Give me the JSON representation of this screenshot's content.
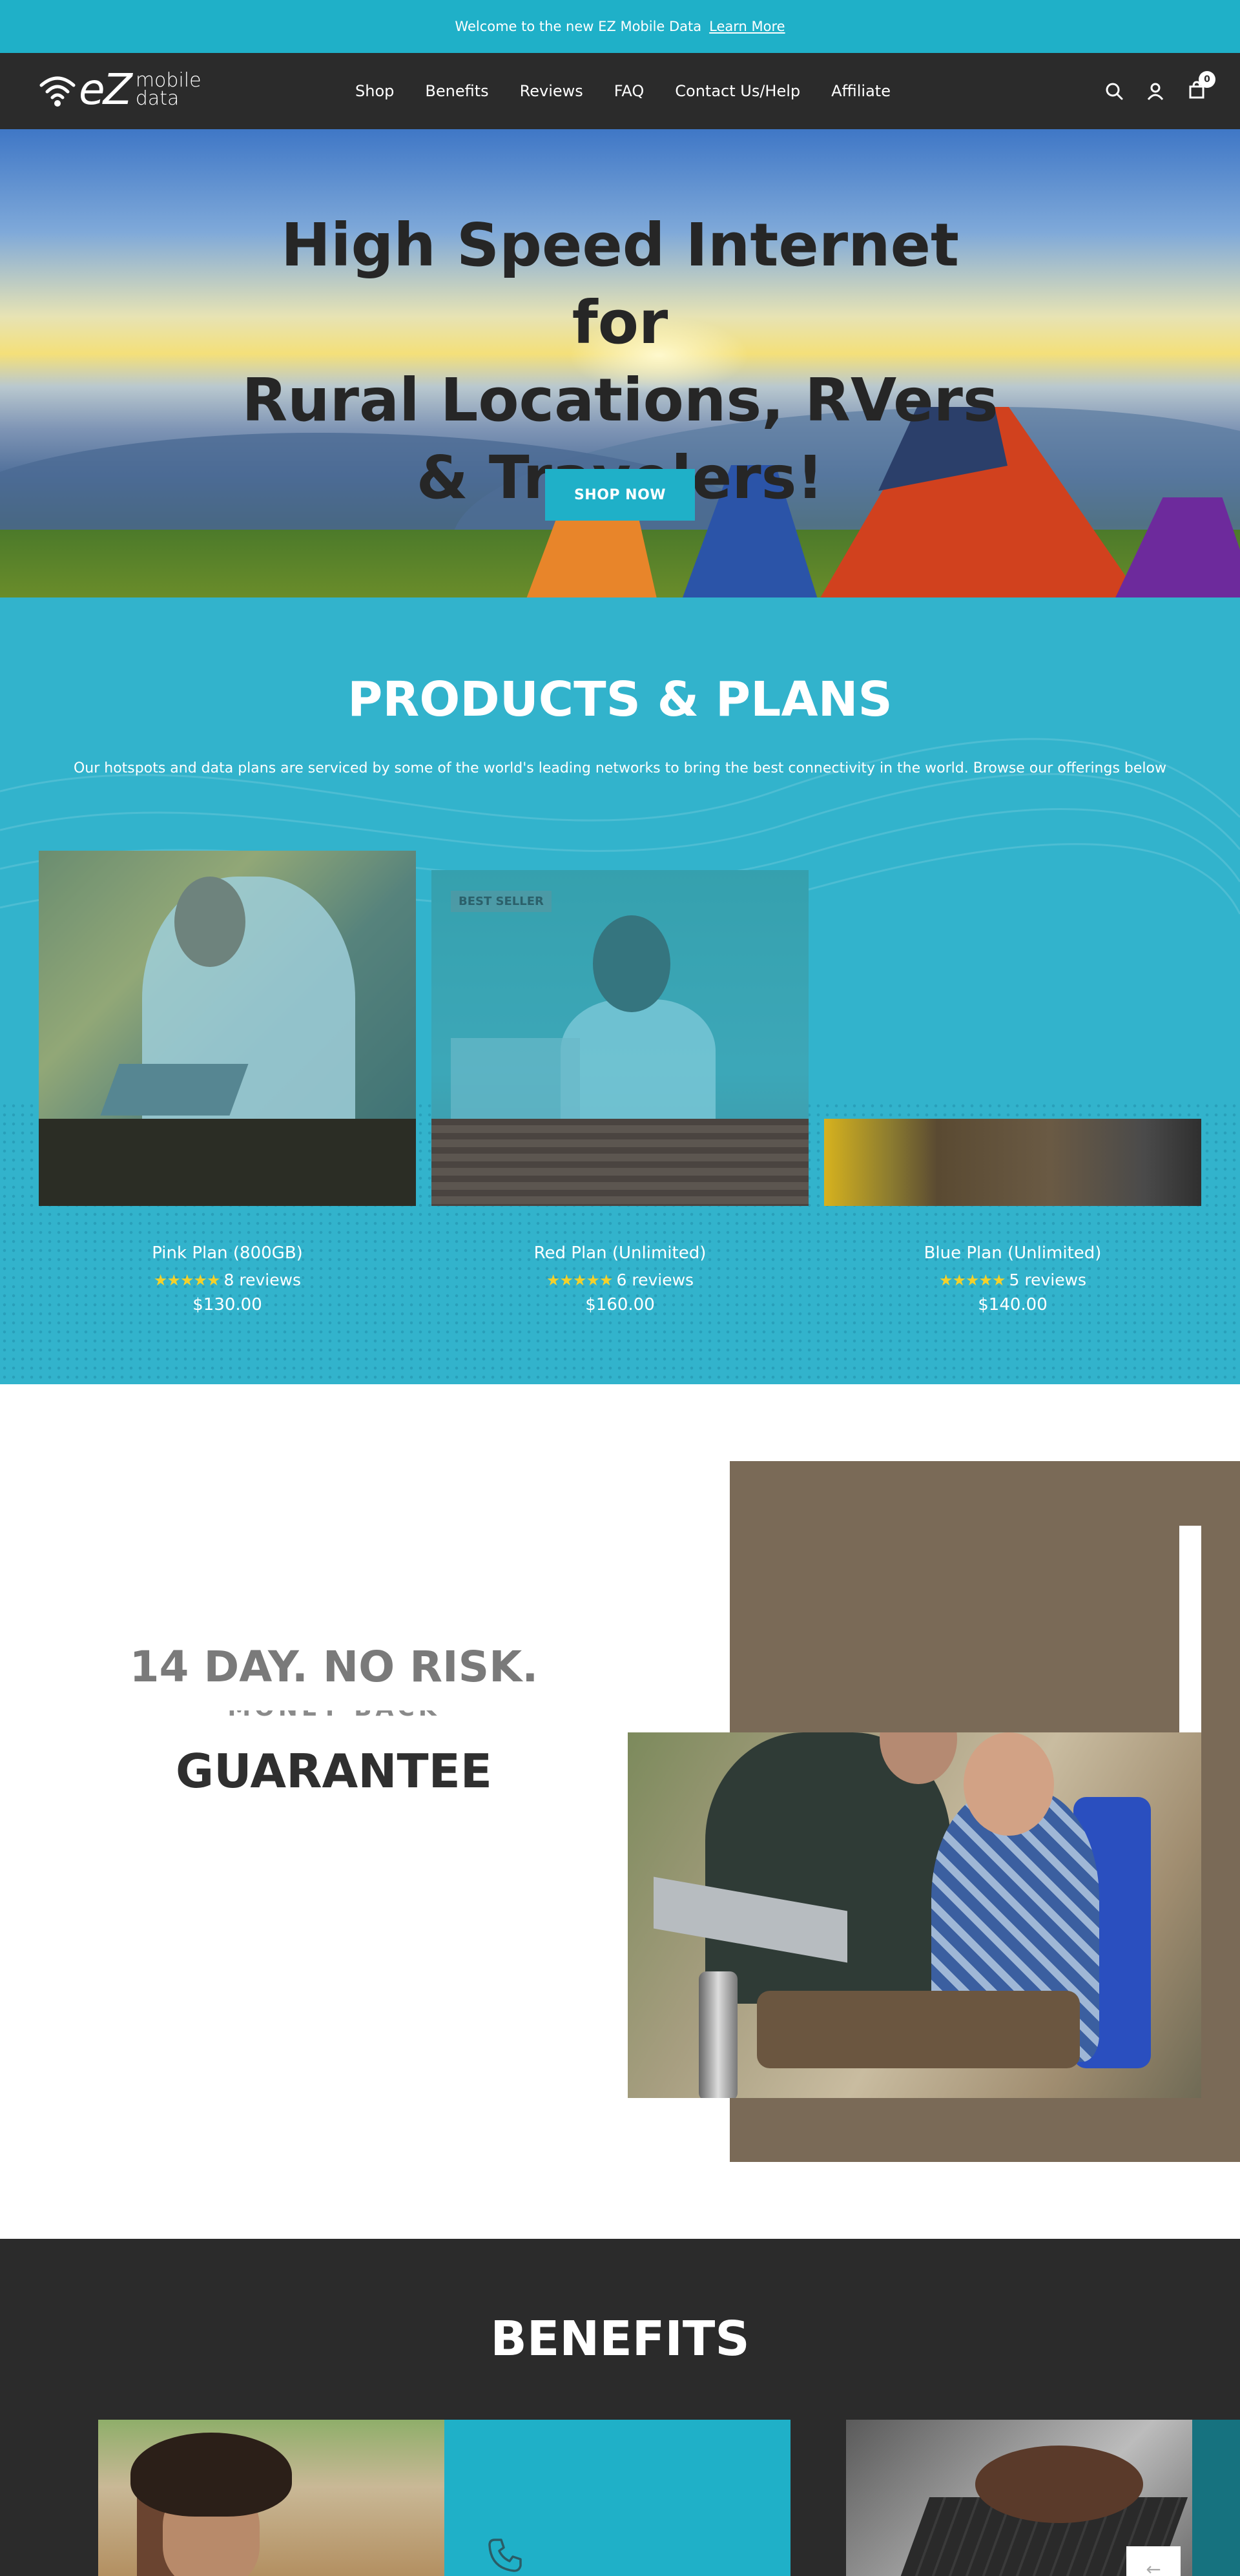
{
  "announcement": {
    "text": "Welcome to the new EZ Mobile Data",
    "link": "Learn More"
  },
  "header": {
    "logo": {
      "ez": "eZ",
      "line1": "mobile",
      "line2": "data"
    },
    "nav": [
      "Shop",
      "Benefits",
      "Reviews",
      "FAQ",
      "Contact Us/Help",
      "Affiliate"
    ],
    "icons": [
      "search-icon",
      "account-icon",
      "cart-icon"
    ],
    "cart_count": "0"
  },
  "hero": {
    "title_line1": "High Speed Internet for",
    "title_line2": "Rural Locations, RVers",
    "title_line3": "& Travelers!",
    "cta": "SHOP NOW"
  },
  "products": {
    "title": "PRODUCTS & PLANS",
    "subtitle": "Our hotspots and data plans are serviced by some of the world's leading networks to bring the best connectivity in the world. Browse our offerings below",
    "items": [
      {
        "name": "Pink Plan (800GB)",
        "stars": "★★★★★",
        "rating": 5,
        "reviews": "8 reviews",
        "price": "$130.00",
        "badge": ""
      },
      {
        "name": "Red Plan (Unlimited)",
        "stars": "★★★★★",
        "rating": 5,
        "reviews": "6 reviews",
        "price": "$160.00",
        "badge": "BEST SELLER"
      },
      {
        "name": "Blue Plan (Unlimited)",
        "stars": "★★★★★",
        "rating": 5,
        "reviews": "5 reviews",
        "price": "$140.00",
        "badge": ""
      }
    ]
  },
  "guarantee": {
    "line1": "14 DAY. NO RISK.",
    "line2": "MONEY BACK",
    "line3": "GUARANTEE"
  },
  "benefits": {
    "title": "BENEFITS",
    "icons": [
      "phone-icon",
      "arrow-left-icon"
    ],
    "arrow": "←"
  },
  "colors": {
    "accent": "#1fb0c8",
    "dark": "#2b2b2b",
    "brown": "#7a6a57",
    "star": "#f4d12b"
  }
}
